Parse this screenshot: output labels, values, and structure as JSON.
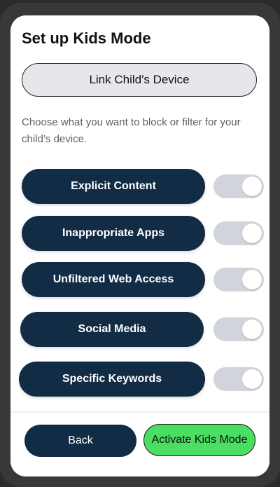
{
  "header": {
    "title": "Set up Kids Mode"
  },
  "link_device": {
    "label": "Link Child's Device"
  },
  "description": "Choose what you want to block or filter for your child’s device.",
  "filters": [
    {
      "label": "Explicit Content",
      "toggle_on": false
    },
    {
      "label": "Inappropriate Apps",
      "toggle_on": false
    },
    {
      "label": "Unfiltered Web Access",
      "toggle_on": false
    },
    {
      "label": "Social Media",
      "toggle_on": false
    },
    {
      "label": "Specific Keywords",
      "toggle_on": false
    }
  ],
  "footer": {
    "back_label": "Back",
    "activate_label": "Activate Kids Mode"
  },
  "colors": {
    "primary": "#122c46",
    "accent": "#4ade63",
    "toggle_track": "#d1d5db",
    "secondary_button": "#e5e7eb"
  }
}
